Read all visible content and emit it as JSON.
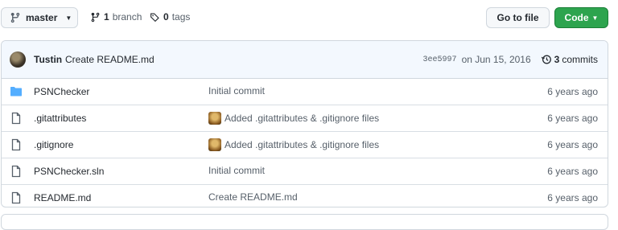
{
  "toolbar": {
    "branch_name": "master",
    "branch_count": "1",
    "branch_word": "branch",
    "tag_count": "0",
    "tag_word": "tags",
    "goto_label": "Go to file",
    "code_label": "Code"
  },
  "commit": {
    "author": "Tustin",
    "message": "Create README.md",
    "sha": "3ee5997",
    "date": "on Jun 15, 2016",
    "count": "3",
    "count_word": "commits"
  },
  "files": [
    {
      "name": "PSNChecker",
      "type": "folder",
      "message": "Initial commit",
      "has_avatar": false,
      "age": "6 years ago"
    },
    {
      "name": ".gitattributes",
      "type": "file",
      "message": "Added .gitattributes & .gitignore files",
      "has_avatar": true,
      "age": "6 years ago"
    },
    {
      "name": ".gitignore",
      "type": "file",
      "message": "Added .gitattributes & .gitignore files",
      "has_avatar": true,
      "age": "6 years ago"
    },
    {
      "name": "PSNChecker.sln",
      "type": "file",
      "message": "Initial commit",
      "has_avatar": false,
      "age": "6 years ago"
    },
    {
      "name": "README.md",
      "type": "file",
      "message": "Create README.md",
      "has_avatar": false,
      "age": "6 years ago"
    }
  ],
  "colors": {
    "folder": "#54aeff",
    "primary": "#2da44e"
  }
}
